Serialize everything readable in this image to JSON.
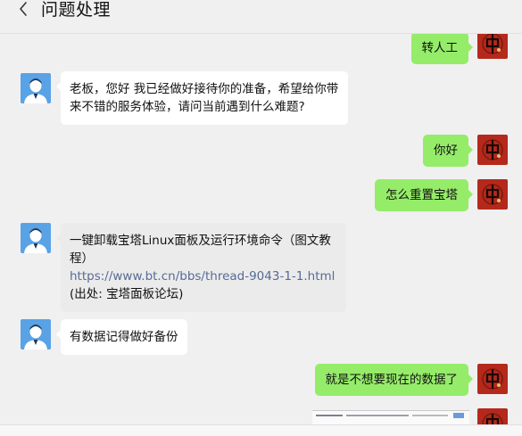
{
  "header": {
    "title": "问题处理",
    "back_icon": "chevron-left-icon"
  },
  "colors": {
    "background": "#f0f0f0",
    "my_bubble": "#95ec69",
    "other_bubble": "#ffffff",
    "card_bubble": "#ebebeb",
    "link": "#576b95"
  },
  "messages": [
    {
      "from": "me",
      "text": "转人工"
    },
    {
      "from": "agent",
      "text": "老板，您好  我已经做好接待你的准备，希望给你带来不错的服务体验，请问当前遇到什么难题?"
    },
    {
      "from": "me",
      "text": "你好"
    },
    {
      "from": "me",
      "text": "怎么重置宝塔"
    },
    {
      "from": "agent",
      "type": "link-card",
      "title": "一键卸载宝塔Linux面板及运行环境命令（图文教程）",
      "url": "https://www.bt.cn/bbs/thread-9043-1-1.html",
      "source": "(出处: 宝塔面板论坛)"
    },
    {
      "from": "agent",
      "text": "有数据记得做好备份"
    },
    {
      "from": "me",
      "text": "就是不想要现在的数据了"
    },
    {
      "from": "me",
      "type": "image"
    }
  ]
}
